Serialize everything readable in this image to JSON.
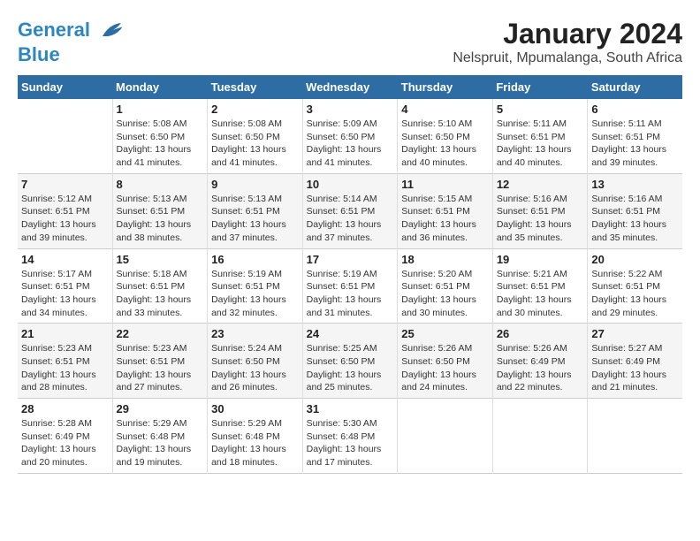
{
  "app": {
    "logo_line1": "General",
    "logo_line2": "Blue"
  },
  "header": {
    "title": "January 2024",
    "subtitle": "Nelspruit, Mpumalanga, South Africa"
  },
  "weekdays": [
    "Sunday",
    "Monday",
    "Tuesday",
    "Wednesday",
    "Thursday",
    "Friday",
    "Saturday"
  ],
  "weeks": [
    [
      {
        "day": "",
        "info": ""
      },
      {
        "day": "1",
        "info": "Sunrise: 5:08 AM\nSunset: 6:50 PM\nDaylight: 13 hours\nand 41 minutes."
      },
      {
        "day": "2",
        "info": "Sunrise: 5:08 AM\nSunset: 6:50 PM\nDaylight: 13 hours\nand 41 minutes."
      },
      {
        "day": "3",
        "info": "Sunrise: 5:09 AM\nSunset: 6:50 PM\nDaylight: 13 hours\nand 41 minutes."
      },
      {
        "day": "4",
        "info": "Sunrise: 5:10 AM\nSunset: 6:50 PM\nDaylight: 13 hours\nand 40 minutes."
      },
      {
        "day": "5",
        "info": "Sunrise: 5:11 AM\nSunset: 6:51 PM\nDaylight: 13 hours\nand 40 minutes."
      },
      {
        "day": "6",
        "info": "Sunrise: 5:11 AM\nSunset: 6:51 PM\nDaylight: 13 hours\nand 39 minutes."
      }
    ],
    [
      {
        "day": "7",
        "info": "Sunrise: 5:12 AM\nSunset: 6:51 PM\nDaylight: 13 hours\nand 39 minutes."
      },
      {
        "day": "8",
        "info": "Sunrise: 5:13 AM\nSunset: 6:51 PM\nDaylight: 13 hours\nand 38 minutes."
      },
      {
        "day": "9",
        "info": "Sunrise: 5:13 AM\nSunset: 6:51 PM\nDaylight: 13 hours\nand 37 minutes."
      },
      {
        "day": "10",
        "info": "Sunrise: 5:14 AM\nSunset: 6:51 PM\nDaylight: 13 hours\nand 37 minutes."
      },
      {
        "day": "11",
        "info": "Sunrise: 5:15 AM\nSunset: 6:51 PM\nDaylight: 13 hours\nand 36 minutes."
      },
      {
        "day": "12",
        "info": "Sunrise: 5:16 AM\nSunset: 6:51 PM\nDaylight: 13 hours\nand 35 minutes."
      },
      {
        "day": "13",
        "info": "Sunrise: 5:16 AM\nSunset: 6:51 PM\nDaylight: 13 hours\nand 35 minutes."
      }
    ],
    [
      {
        "day": "14",
        "info": "Sunrise: 5:17 AM\nSunset: 6:51 PM\nDaylight: 13 hours\nand 34 minutes."
      },
      {
        "day": "15",
        "info": "Sunrise: 5:18 AM\nSunset: 6:51 PM\nDaylight: 13 hours\nand 33 minutes."
      },
      {
        "day": "16",
        "info": "Sunrise: 5:19 AM\nSunset: 6:51 PM\nDaylight: 13 hours\nand 32 minutes."
      },
      {
        "day": "17",
        "info": "Sunrise: 5:19 AM\nSunset: 6:51 PM\nDaylight: 13 hours\nand 31 minutes."
      },
      {
        "day": "18",
        "info": "Sunrise: 5:20 AM\nSunset: 6:51 PM\nDaylight: 13 hours\nand 30 minutes."
      },
      {
        "day": "19",
        "info": "Sunrise: 5:21 AM\nSunset: 6:51 PM\nDaylight: 13 hours\nand 30 minutes."
      },
      {
        "day": "20",
        "info": "Sunrise: 5:22 AM\nSunset: 6:51 PM\nDaylight: 13 hours\nand 29 minutes."
      }
    ],
    [
      {
        "day": "21",
        "info": "Sunrise: 5:23 AM\nSunset: 6:51 PM\nDaylight: 13 hours\nand 28 minutes."
      },
      {
        "day": "22",
        "info": "Sunrise: 5:23 AM\nSunset: 6:51 PM\nDaylight: 13 hours\nand 27 minutes."
      },
      {
        "day": "23",
        "info": "Sunrise: 5:24 AM\nSunset: 6:50 PM\nDaylight: 13 hours\nand 26 minutes."
      },
      {
        "day": "24",
        "info": "Sunrise: 5:25 AM\nSunset: 6:50 PM\nDaylight: 13 hours\nand 25 minutes."
      },
      {
        "day": "25",
        "info": "Sunrise: 5:26 AM\nSunset: 6:50 PM\nDaylight: 13 hours\nand 24 minutes."
      },
      {
        "day": "26",
        "info": "Sunrise: 5:26 AM\nSunset: 6:49 PM\nDaylight: 13 hours\nand 22 minutes."
      },
      {
        "day": "27",
        "info": "Sunrise: 5:27 AM\nSunset: 6:49 PM\nDaylight: 13 hours\nand 21 minutes."
      }
    ],
    [
      {
        "day": "28",
        "info": "Sunrise: 5:28 AM\nSunset: 6:49 PM\nDaylight: 13 hours\nand 20 minutes."
      },
      {
        "day": "29",
        "info": "Sunrise: 5:29 AM\nSunset: 6:48 PM\nDaylight: 13 hours\nand 19 minutes."
      },
      {
        "day": "30",
        "info": "Sunrise: 5:29 AM\nSunset: 6:48 PM\nDaylight: 13 hours\nand 18 minutes."
      },
      {
        "day": "31",
        "info": "Sunrise: 5:30 AM\nSunset: 6:48 PM\nDaylight: 13 hours\nand 17 minutes."
      },
      {
        "day": "",
        "info": ""
      },
      {
        "day": "",
        "info": ""
      },
      {
        "day": "",
        "info": ""
      }
    ]
  ]
}
